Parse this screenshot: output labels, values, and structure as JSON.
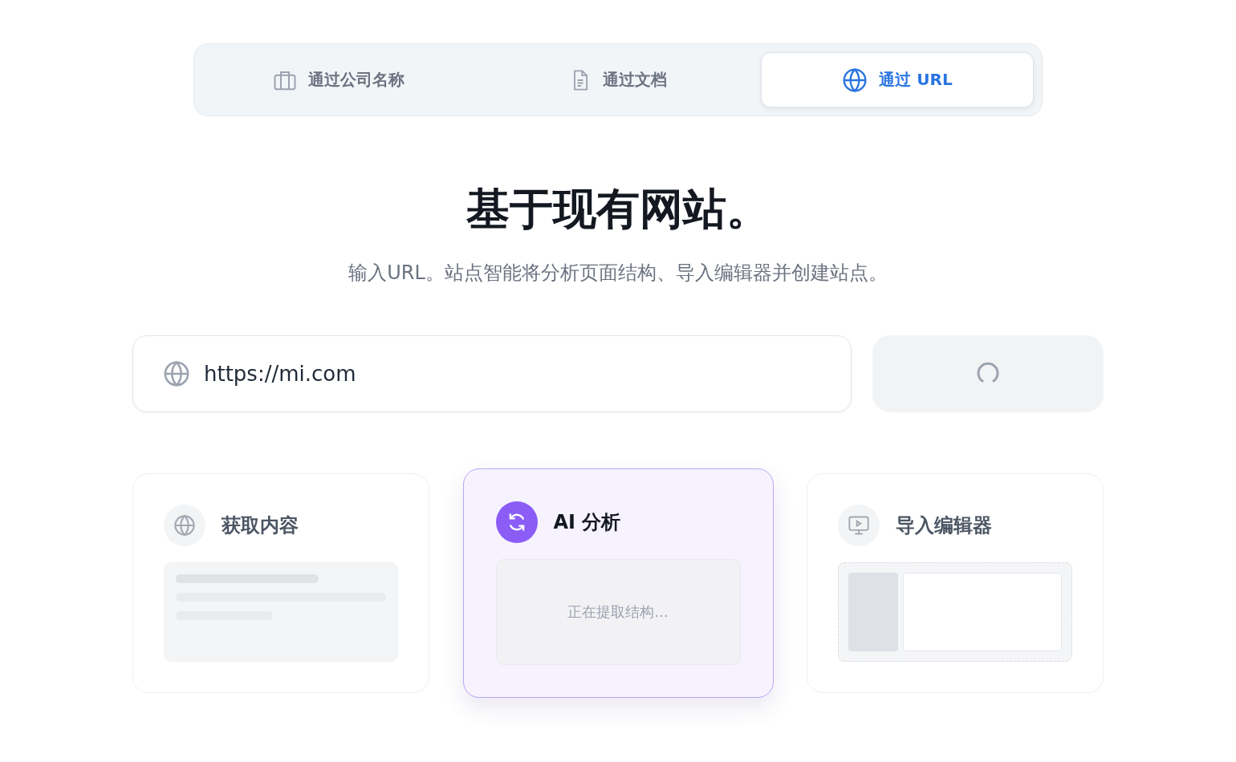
{
  "tabs": [
    {
      "label": "通过公司名称",
      "kind": "briefcase",
      "selected": false
    },
    {
      "label": "通过文档",
      "kind": "document",
      "selected": false
    },
    {
      "label": "通过 URL",
      "kind": "globe",
      "selected": true
    }
  ],
  "heading": "基于现有网站。",
  "subtitle": "输入URL。站点智能将分析页面结构、导入编辑器并创建站点。",
  "url_field": {
    "value": "https://mi.com"
  },
  "submit_button": {
    "loading": true
  },
  "steps": [
    {
      "kind": "fetch",
      "title": "获取内容",
      "active": false
    },
    {
      "kind": "analyze",
      "title": "AI 分析",
      "active": true,
      "status": "正在提取结构..."
    },
    {
      "kind": "import",
      "title": "导入编辑器",
      "active": false
    }
  ]
}
